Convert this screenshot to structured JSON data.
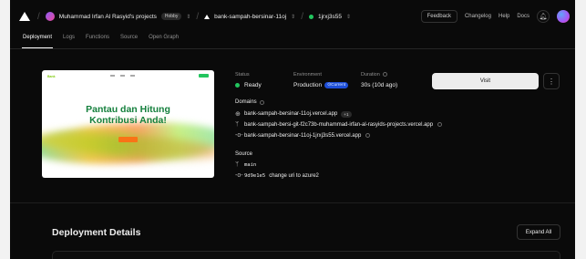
{
  "header": {
    "team_name": "Muhammad Irfan Al Rasyid's projects",
    "plan_badge": "Hobby",
    "project_name": "bank-sampah-bersinar-11oj",
    "deployment_id": "1jrxj3s55",
    "feedback_label": "Feedback",
    "nav_links": [
      "Changelog",
      "Help",
      "Docs"
    ]
  },
  "tabs": [
    "Deployment",
    "Logs",
    "Functions",
    "Source",
    "Open Graph"
  ],
  "preview": {
    "headline_line1": "Pantau dan Hitung",
    "headline_line2": "Kontribusi Anda!",
    "brand_small": "Bank"
  },
  "status": {
    "label": "Status",
    "value": "Ready"
  },
  "environment": {
    "label": "Environment",
    "value": "Production",
    "badge": "Current"
  },
  "duration": {
    "label": "Duration",
    "value": "30s (10d ago)"
  },
  "visit_label": "Visit",
  "more_icon": "⋮",
  "domains": {
    "label": "Domains",
    "primary": "bank-sampah-bersinar-11oj.vercel.app",
    "primary_badge": "+1",
    "git_branch_domain": "bank-sampah-bersi-git-f2c73b-muhammad-irfan-al-rasyids-projects.vercel.app",
    "deployment_domain": "bank-sampah-bersinar-11oj-1jrxj3s55.vercel.app"
  },
  "source": {
    "label": "Source",
    "branch": "main",
    "commit_hash": "9d9e1e5",
    "commit_message": "change uri to azure2"
  },
  "details": {
    "title": "Deployment Details",
    "expand_label": "Expand All"
  },
  "colors": {
    "ready": "#22c55e",
    "current_badge": "#1d4ed8",
    "preview_green": "#15803d"
  }
}
